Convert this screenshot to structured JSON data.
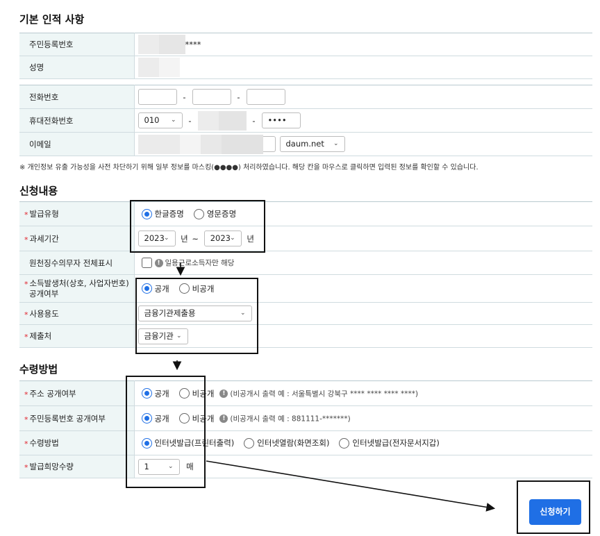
{
  "sections": {
    "basic": "기본 인적 사항",
    "request": "신청내용",
    "receive": "수령방법"
  },
  "basic": {
    "rrn_label": "주민등록번호",
    "rrn_value": "****",
    "name_label": "성명",
    "phone_label": "전화번호",
    "mobile_label": "휴대전화번호",
    "mobile_prefix": "010",
    "mobile_last": "••••",
    "email_label": "이메일",
    "email_domain": "daum.net",
    "dash": "-"
  },
  "notice": "※ 개인정보 유출 가능성을 사전 차단하기 위해 일부 정보를 마스킹(●●●●) 처리하였습니다. 해당 칸을 마우스로 클릭하면 입력된 정보를 확인할 수 있습니다.",
  "request": {
    "type_label": "발급유형",
    "type_korean": "한글증명",
    "type_english": "영문증명",
    "period_label": "과세기간",
    "period_from": "2023",
    "period_to": "2023",
    "year_unit": "년",
    "tilde": "~",
    "withholder_label": "원천징수의무자 전체표시",
    "withholder_hint": "일용근로소득자만 해당",
    "disclose_label_1": "소득발생처(상호, 사업자번호)",
    "disclose_label_2": "공개여부",
    "disclose_public": "공개",
    "disclose_private": "비공개",
    "purpose_label": "사용용도",
    "purpose_value": "금융기관제출용",
    "submit_to_label": "제출처",
    "submit_to_value": "금융기관"
  },
  "receive": {
    "addr_label": "주소 공개여부",
    "addr_public": "공개",
    "addr_private": "비공개",
    "addr_hint": "(비공개시 출력 예 : 서울특별시 강북구 **** **** **** ****)",
    "rrn_label": "주민등록번호 공개여부",
    "rrn_public": "공개",
    "rrn_private": "비공개",
    "rrn_hint": "(비공개시 출력 예 : 881111-*******)",
    "method_label": "수령방법",
    "method_print": "인터넷발급(프린터출력)",
    "method_view": "인터넷열람(화면조회)",
    "method_edoc": "인터넷발급(전자문서지갑)",
    "copies_label": "발급희망수량",
    "copies_value": "1",
    "copies_unit": "매"
  },
  "submit_label": "신청하기",
  "colors": {
    "accent": "#1f6fe5",
    "label_bg": "#eef6f6",
    "required": "#e0242e"
  }
}
